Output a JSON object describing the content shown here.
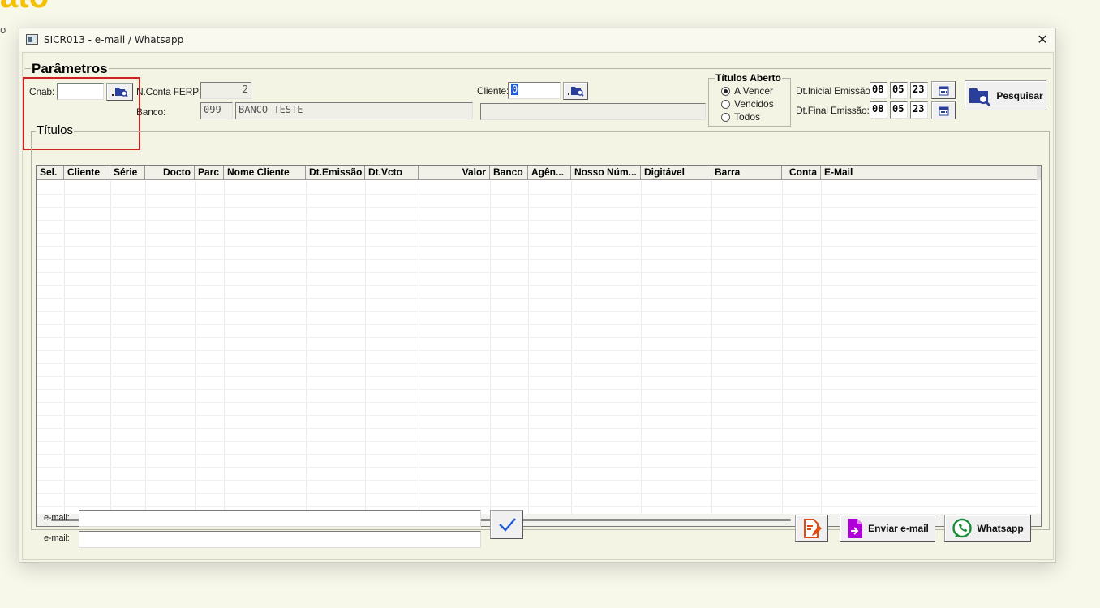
{
  "background": {
    "logo_fragment": "ato",
    "char": "o"
  },
  "window": {
    "title": "SICR013 - e-mail / Whatsapp",
    "close_glyph": "✕"
  },
  "parametros": {
    "legend": "Parâmetros",
    "cnab_label": "Cnab:",
    "cnab_value": "",
    "nconta_label": "N.Conta FERP:",
    "nconta_value": "2",
    "banco_label": "Banco:",
    "banco_code": "099",
    "banco_name": "BANCO TESTE",
    "cliente_label": "Cliente:",
    "cliente_value": "0",
    "cliente_name": ""
  },
  "titulos_aberto": {
    "legend": "Títulos Aberto",
    "options": [
      {
        "label": "A Vencer",
        "selected": true
      },
      {
        "label": "Vencidos",
        "selected": false
      },
      {
        "label": "Todos",
        "selected": false
      }
    ]
  },
  "dates": {
    "inicial_label": "Dt.Inicial Emissão:",
    "inicial": {
      "d": "08",
      "m": "05",
      "y": "23"
    },
    "final_label": "Dt.Final Emissão:",
    "final": {
      "d": "08",
      "m": "05",
      "y": "23"
    }
  },
  "pesquisar_label": "Pesquisar",
  "titulos": {
    "legend": "Títulos",
    "columns": [
      "Sel.",
      "Cliente",
      "Série",
      "Docto",
      "Parc",
      "Nome Cliente",
      "Dt.Emissão",
      "Dt.Vcto",
      "Valor",
      "Banco",
      "Agên...",
      "Nosso Núm...",
      "Digitável",
      "Barra",
      "Conta",
      "E-Mail"
    ]
  },
  "email": {
    "label1": "e-mail:",
    "value1": "",
    "label2": "e-mail:",
    "value2": ""
  },
  "actions": {
    "enviar_email": "Enviar e-mail",
    "whatsapp": "Whatsapp"
  },
  "colors": {
    "highlight": "#d02020",
    "email_icon": "#b000d8",
    "whatsapp": "#1a8c3a",
    "edit_icon": "#e04a10",
    "search_icon": "#2a3f9a"
  }
}
